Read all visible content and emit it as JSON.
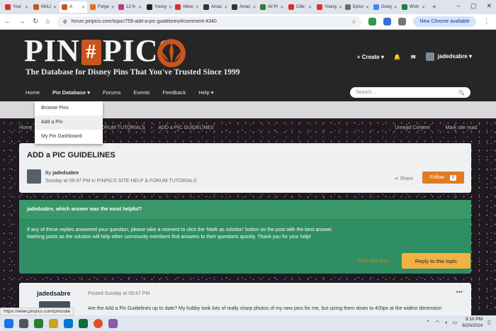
{
  "browser": {
    "tabs": [
      {
        "label": "Your",
        "icon": "gmail-icon",
        "color": "#d93025",
        "active": false
      },
      {
        "label": "MALI",
        "icon": "pinpics-icon",
        "color": "#c8561c",
        "active": false
      },
      {
        "label": "A",
        "icon": "pinpics-icon",
        "color": "#c8561c",
        "active": true
      },
      {
        "label": "Forge",
        "icon": "forge-icon",
        "color": "#e0701c",
        "active": false
      },
      {
        "label": "12 N",
        "icon": "instagram-icon",
        "color": "#c13584",
        "active": false
      },
      {
        "label": "Young",
        "icon": "imdb-icon",
        "color": "#222222",
        "active": false
      },
      {
        "label": "Inbox",
        "icon": "gmail-icon",
        "color": "#d93025",
        "active": false
      },
      {
        "label": "Amaz",
        "icon": "amazon-icon",
        "color": "#333333",
        "active": false
      },
      {
        "label": "Amaz",
        "icon": "amazon-icon",
        "color": "#333333",
        "active": false
      },
      {
        "label": "All Pr",
        "icon": "check-icon",
        "color": "#2e7d32",
        "active": false
      },
      {
        "label": "Citie",
        "icon": "youtube-icon",
        "color": "#e52d27",
        "active": false
      },
      {
        "label": "Young",
        "icon": "youtube-icon",
        "color": "#e52d27",
        "active": false
      },
      {
        "label": "Episo",
        "icon": "page-icon",
        "color": "#6b6b6b",
        "active": false
      },
      {
        "label": "Goog",
        "icon": "docs-icon",
        "color": "#4285f4",
        "active": false
      },
      {
        "label": "Wish",
        "icon": "sheets-icon",
        "color": "#1e7e45",
        "active": false
      }
    ],
    "url": "forum.pinpics.com/topic/759-add-a-pic-guidelines/#comment-4340",
    "update_label": "New Chrome available"
  },
  "site": {
    "logo_left": "PIN",
    "logo_hash": "#",
    "logo_right": "PICS",
    "tagline": "The Database for Disney Pins That You've Trusted Since 1999",
    "create_label": "+ Create ▾",
    "username": "jadedsabre ▾",
    "nav": [
      "Home",
      "Pin Database ▾",
      "Forums",
      "Events",
      "Feedback",
      "Help ▾"
    ],
    "search_placeholder": "Search...",
    "dropdown": [
      "Browse Pins",
      "Add a Pin",
      "My Pin Dashboard"
    ],
    "breadcrumb": [
      "Home",
      "PINPICS SITE HELP & FORUM TUTORIALS",
      "ADD a PIC GUIDELINES"
    ],
    "breadcrumb_right": [
      "Unread Content",
      "Mark site read"
    ]
  },
  "topic": {
    "title": "ADD a PIC GUIDELINES",
    "by_prefix": "By ",
    "author": "jadedsabre",
    "when": "Sunday at 09:47 PM in PINPICS SITE HELP & FORUM TUTORIALS",
    "share": "Share",
    "follow": "Follow",
    "follow_count": "0"
  },
  "solution_box": {
    "heading": "jadedsabre, which answer was the most helpful?",
    "line1": "If any of these replies answered your question, please take a moment to click the 'Mark as solution' button on the post with the best answer.",
    "line2": "Marking posts as the solution will help other community members find answers to their questions quickly. Thank you for your help!"
  },
  "actions": {
    "start_new": "Start new topic",
    "reply": "Reply to this topic"
  },
  "post": {
    "author": "jadedsabre",
    "date": "Posted Sunday at 09:47 PM",
    "menu": "•••",
    "text": "Are the Add a Pic Guidelines up to date?  My hubby took lots of really sharp photos of my new pins for me, but sizing them down to 400px at the widest dimension"
  },
  "status_url": "https://www.pinpics.com/pincrate",
  "taskbar": {
    "time": "9:10 PM",
    "date": "8/20/2024"
  }
}
